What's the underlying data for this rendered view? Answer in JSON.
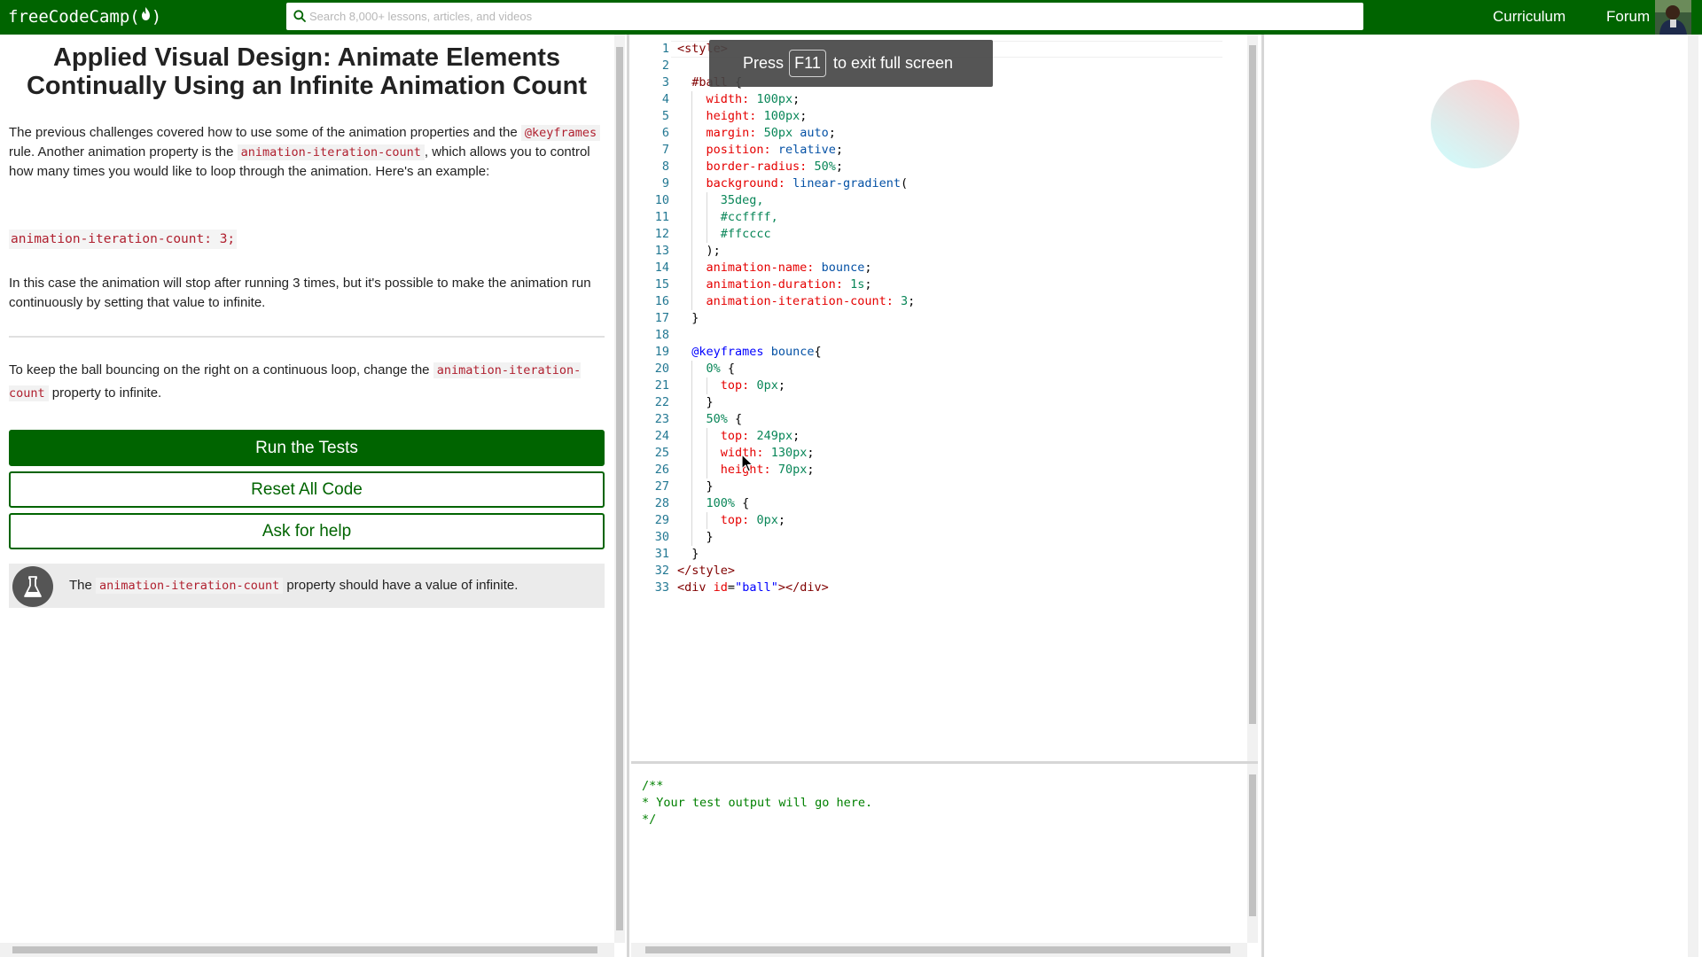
{
  "nav": {
    "logo_text": "freeCodeCamp(",
    "logo_text_end": ")",
    "search_placeholder": "Search 8,000+ lessons, articles, and videos",
    "links": [
      "Curriculum",
      "Forum"
    ]
  },
  "challenge": {
    "title": "Applied Visual Design: Animate Elements Continually Using an Infinite Animation Count",
    "p1": {
      "a": "The previous challenges covered how to use some of the animation properties and the ",
      "code1": "@keyframes",
      "b": " rule. Another animation property is the ",
      "code2": "animation-iteration-count",
      "c": ", which allows you to control how many times you would like to loop through the animation. Here's an example:"
    },
    "example_code": "animation-iteration-count: 3;",
    "p2": "In this case the animation will stop after running 3 times, but it's possible to make the animation run continuously by setting that value to infinite.",
    "p3": {
      "a": "To keep the ball bouncing on the right on a continuous loop, change the ",
      "code": "animation-iteration-count",
      "b": " property to infinite."
    },
    "buttons": {
      "run": "Run the Tests",
      "reset": "Reset All Code",
      "help": "Ask for help"
    },
    "test": {
      "a": "The ",
      "code": "animation-iteration-count",
      "b": " property should have a value of infinite."
    }
  },
  "editor": {
    "lines": [
      "<style>",
      "",
      "  #ball {",
      "    width: 100px;",
      "    height: 100px;",
      "    margin: 50px auto;",
      "    position: relative;",
      "    border-radius: 50%;",
      "    background: linear-gradient(",
      "      35deg,",
      "      #ccffff,",
      "      #ffcccc",
      "    );",
      "    animation-name: bounce;",
      "    animation-duration: 1s;",
      "    animation-iteration-count: 3;",
      "  }",
      "",
      "  @keyframes bounce{",
      "    0% {",
      "      top: 0px;",
      "    }",
      "    50% {",
      "      top: 249px;",
      "      width: 130px;",
      "      height: 70px;",
      "    }",
      "    100% {",
      "      top: 0px;",
      "    }",
      "  }",
      "</style>",
      "<div id=\"ball\"></div>"
    ]
  },
  "fullscreen_toast": {
    "pre": "Press",
    "key": "F11",
    "post": "to exit full screen"
  },
  "output": {
    "lines": [
      "/**",
      "* Your test output will go here.",
      "*/"
    ]
  },
  "colors": {
    "brand_green": "#006400",
    "ball_gradient_start": "#ccffff",
    "ball_gradient_end": "#ffcccc"
  }
}
